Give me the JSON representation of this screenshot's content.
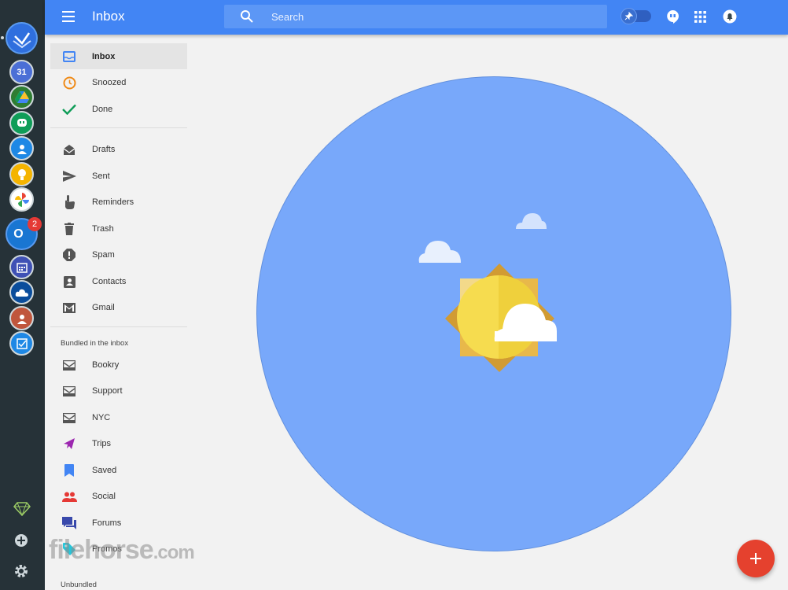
{
  "topbar": {
    "title": "Inbox",
    "search_placeholder": "Search"
  },
  "dock": {
    "apps": [
      "inbox-app",
      "calendar-app",
      "drive-app",
      "hangouts-app",
      "contacts-app",
      "keep-app",
      "photos-app",
      "outlook-app",
      "outlook-calendar-app",
      "onedrive-app",
      "people-app",
      "todo-app"
    ],
    "calendar_day": "31",
    "outlook_letter": "O",
    "outlook_badge": "2"
  },
  "nav": {
    "items": [
      {
        "label": "Inbox",
        "icon": "inbox-icon"
      },
      {
        "label": "Snoozed",
        "icon": "clock-icon"
      },
      {
        "label": "Done",
        "icon": "check-icon"
      }
    ],
    "folders": [
      {
        "label": "Drafts",
        "icon": "drafts-icon"
      },
      {
        "label": "Sent",
        "icon": "send-icon"
      },
      {
        "label": "Reminders",
        "icon": "reminder-icon"
      },
      {
        "label": "Trash",
        "icon": "trash-icon"
      },
      {
        "label": "Spam",
        "icon": "spam-icon"
      },
      {
        "label": "Contacts",
        "icon": "contacts-icon"
      },
      {
        "label": "Gmail",
        "icon": "gmail-icon"
      }
    ],
    "bundled_heading": "Bundled in the inbox",
    "bundles": [
      {
        "label": "Bookry",
        "icon": "label-icon"
      },
      {
        "label": "Support",
        "icon": "label-icon"
      },
      {
        "label": "NYC",
        "icon": "label-icon"
      },
      {
        "label": "Trips",
        "icon": "plane-icon"
      },
      {
        "label": "Saved",
        "icon": "bookmark-icon"
      },
      {
        "label": "Social",
        "icon": "people-icon"
      },
      {
        "label": "Forums",
        "icon": "forum-icon"
      },
      {
        "label": "Promos",
        "icon": "tag-icon"
      }
    ],
    "unbundled_heading": "Unbundled"
  },
  "watermark": {
    "brand": "filehorse",
    "tld": ".com"
  },
  "colors": {
    "accent": "#4285f4",
    "dock": "#263238",
    "sky": "#78a8fa",
    "fab": "#e5412e",
    "sun": "#f5d341"
  }
}
